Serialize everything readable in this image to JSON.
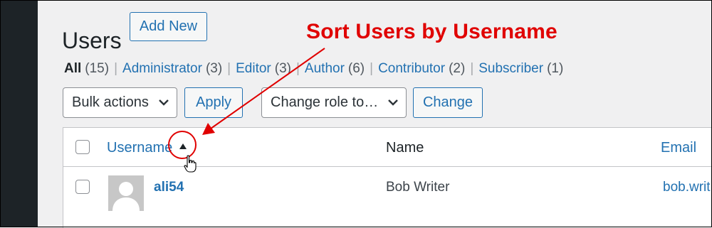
{
  "page": {
    "title": "Users",
    "add_new": "Add New"
  },
  "annotation": "Sort Users by Username",
  "filters": [
    {
      "label": "All",
      "count": "(15)"
    },
    {
      "label": "Administrator",
      "count": "(3)"
    },
    {
      "label": "Editor",
      "count": "(3)"
    },
    {
      "label": "Author",
      "count": "(6)"
    },
    {
      "label": "Contributor",
      "count": "(2)"
    },
    {
      "label": "Subscriber",
      "count": "(1)"
    }
  ],
  "filter_separator": "|",
  "bulk": {
    "selected": "Bulk actions",
    "apply": "Apply"
  },
  "role": {
    "selected": "Change role to…",
    "change": "Change"
  },
  "table": {
    "columns": {
      "username": "Username",
      "name": "Name",
      "email": "Email"
    },
    "rows": [
      {
        "username": "ali54",
        "name": "Bob Writer",
        "email": "bob.writ"
      }
    ]
  },
  "colors": {
    "accent": "#2271b1",
    "annotation": "#e00000",
    "sidebar": "#1d2327"
  }
}
